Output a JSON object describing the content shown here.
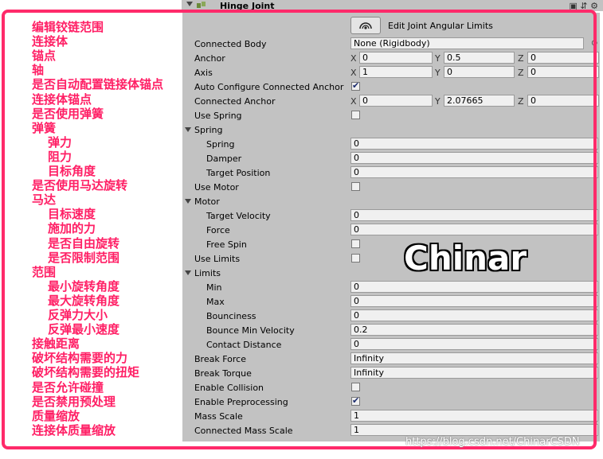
{
  "header": {
    "component_title": "Hinge Joint",
    "icons": [
      "book-icon",
      "preset-icon",
      "gear-icon"
    ]
  },
  "edit_limits": {
    "label": "Edit Joint Angular Limits",
    "icon": "joint-limits-icon"
  },
  "annotations": [
    "编辑铰链范围",
    "连接体",
    "锚点",
    "轴",
    "是否自动配置链接体锚点",
    "连接体锚点",
    "是否使用弹簧",
    "弹簧",
    "弹力",
    "阻力",
    "目标角度",
    "是否使用马达旋转",
    "马达",
    "目标速度",
    "施加的力",
    "是否自由旋转",
    "是否限制范围",
    "范围",
    "最小旋转角度",
    "最大旋转角度",
    "反弹力大小",
    "反弹最小速度",
    "接触距离",
    "破坏结构需要的力",
    "破坏结构需要的扭矩",
    "是否允许碰撞",
    "是否禁用预处理",
    "质量缩放",
    "连接体质量缩放"
  ],
  "props": {
    "connected_body": {
      "label": "Connected Body",
      "value": "None (Rigidbody)"
    },
    "anchor": {
      "label": "Anchor",
      "x": "0",
      "y": "0.5",
      "z": "0"
    },
    "axis": {
      "label": "Axis",
      "x": "1",
      "y": "0",
      "z": "0"
    },
    "auto_configure": {
      "label": "Auto Configure Connected Anchor",
      "checked": true
    },
    "connected_anchor": {
      "label": "Connected Anchor",
      "x": "0",
      "y": "2.07665",
      "z": "0"
    },
    "use_spring": {
      "label": "Use Spring",
      "checked": false
    },
    "spring_section": {
      "label": "Spring"
    },
    "spring": {
      "label": "Spring",
      "value": "0"
    },
    "damper": {
      "label": "Damper",
      "value": "0"
    },
    "target_position": {
      "label": "Target Position",
      "value": "0"
    },
    "use_motor": {
      "label": "Use Motor",
      "checked": false
    },
    "motor_section": {
      "label": "Motor"
    },
    "target_velocity": {
      "label": "Target Velocity",
      "value": "0"
    },
    "force": {
      "label": "Force",
      "value": "0"
    },
    "free_spin": {
      "label": "Free Spin",
      "checked": false
    },
    "use_limits": {
      "label": "Use Limits",
      "checked": false
    },
    "limits_section": {
      "label": "Limits"
    },
    "min": {
      "label": "Min",
      "value": "0"
    },
    "max": {
      "label": "Max",
      "value": "0"
    },
    "bounciness": {
      "label": "Bounciness",
      "value": "0"
    },
    "bounce_min_velocity": {
      "label": "Bounce Min Velocity",
      "value": "0.2"
    },
    "contact_distance": {
      "label": "Contact Distance",
      "value": "0"
    },
    "break_force": {
      "label": "Break Force",
      "value": "Infinity"
    },
    "break_torque": {
      "label": "Break Torque",
      "value": "Infinity"
    },
    "enable_collision": {
      "label": "Enable Collision",
      "checked": false
    },
    "enable_preprocessing": {
      "label": "Enable Preprocessing",
      "checked": true
    },
    "mass_scale": {
      "label": "Mass Scale",
      "value": "1"
    },
    "connected_mass_scale": {
      "label": "Connected Mass Scale",
      "value": "1"
    }
  },
  "axis_letters": {
    "x": "X",
    "y": "Y",
    "z": "Z"
  },
  "brand_text": "Chinar",
  "watermark": "https://blog.csdn.net/ChinarCSDN",
  "colors": {
    "annotation": "#ff1f65",
    "frame": "#ff2a6a",
    "inspector_bg": "#c2c2c2"
  }
}
